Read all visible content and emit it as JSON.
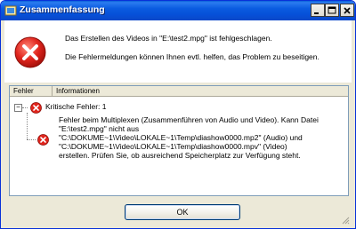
{
  "window": {
    "title": "Zusammenfassung",
    "controls": {
      "minimize": "minimize",
      "maximize": "maximize",
      "close": "close"
    }
  },
  "message": {
    "line1": "Das Erstellen des Videos in \"E:\\test2.mpg\" ist fehlgeschlagen.",
    "line2": "Die Fehlermeldungen können Ihnen evtl. helfen, das Problem zu beseitigen."
  },
  "list": {
    "columns": [
      "Fehler",
      "Informationen"
    ],
    "root": {
      "label": "Kritische Fehler: 1",
      "expanded": true,
      "toggle": "−"
    },
    "detail_lines": [
      "Fehler beim Multiplexen (Zusammenführen von Audio und Video). Kann Datei",
      "\"E:\\test2.mpg\" nicht aus",
      "\"C:\\DOKUME~1\\Video\\LOKALE~1\\Temp\\diashow0000.mp2\" (Audio) und",
      "\"C:\\DOKUME~1\\Video\\LOKALE~1\\Temp\\diashow0000.mpv\" (Video)",
      "erstellen. Prüfen Sie, ob ausreichend Speicherplatz zur Verfügung steht."
    ]
  },
  "buttons": {
    "ok": "OK"
  },
  "colors": {
    "titlebar": "#0a5be0",
    "error_red": "#e0241c",
    "dialog_bg": "#ece9d8"
  },
  "icons": [
    "app-icon",
    "error-icon",
    "minimize-icon",
    "maximize-icon",
    "close-icon",
    "size-grip-icon"
  ]
}
